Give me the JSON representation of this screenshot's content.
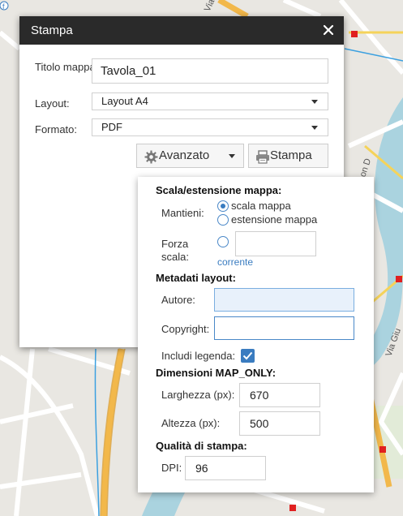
{
  "dialog": {
    "title": "Stampa",
    "fields": {
      "title_label": "Titolo mappa:",
      "title_value": "Tavola_01",
      "layout_label": "Layout:",
      "layout_value": "Layout A4",
      "format_label": "Formato:",
      "format_value": "PDF"
    },
    "buttons": {
      "advanced": "Avanzato",
      "print": "Stampa"
    }
  },
  "advanced": {
    "scale_section": "Scala/estensione mappa:",
    "keep_label": "Mantieni:",
    "keep_options": [
      "scala mappa",
      "estensione mappa"
    ],
    "keep_selected": "scala mappa",
    "force_scale_label": "Forza scala:",
    "force_scale_value": "",
    "current_link": "corrente",
    "metadata_section": "Metadati layout:",
    "author_label": "Autore:",
    "author_value": "",
    "copyright_label": "Copyright:",
    "copyright_value": "",
    "legend_label": "Includi legenda:",
    "legend_checked": true,
    "dimensions_section": "Dimensioni MAP_ONLY:",
    "width_label": "Larghezza (px):",
    "width_value": "670",
    "height_label": "Altezza (px):",
    "height_value": "500",
    "quality_section": "Qualità di stampa:",
    "dpi_label": "DPI:",
    "dpi_value": "96"
  },
  "map": {
    "street_labels": [
      "Via Gi",
      "lio Thaon D",
      "Via Giu"
    ]
  },
  "colors": {
    "header": "#2a2a2a",
    "accent": "#3a7cc0",
    "road_major": "#f2b84b",
    "water": "#aad3df"
  }
}
